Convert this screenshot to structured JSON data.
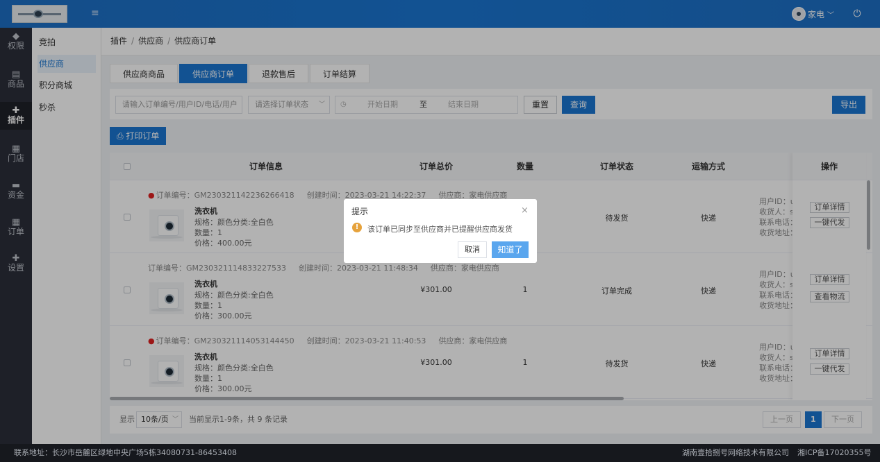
{
  "header": {
    "user_name": "家电",
    "hamburger_glyph": "≡",
    "power_glyph": "⏻",
    "chevron_glyph": "﹀"
  },
  "rail": [
    {
      "icon": "shield-icon",
      "glyph": "◆",
      "label": "权限"
    },
    {
      "icon": "mail-icon",
      "glyph": "▤",
      "label": "商品"
    },
    {
      "icon": "puzzle-icon",
      "glyph": "✚",
      "label": "插件"
    },
    {
      "icon": "doc-icon",
      "glyph": "▦",
      "label": "门店"
    },
    {
      "icon": "wallet-icon",
      "glyph": "▬",
      "label": "资金"
    },
    {
      "icon": "list-icon",
      "glyph": "▦",
      "label": "订单"
    },
    {
      "icon": "puzzle-icon",
      "glyph": "✚",
      "label": "设置"
    }
  ],
  "submenu": [
    "竞拍",
    "供应商",
    "积分商城",
    "秒杀"
  ],
  "breadcrumb": [
    "插件",
    "供应商",
    "供应商订单"
  ],
  "tabs": [
    "供应商商品",
    "供应商订单",
    "退款售后",
    "订单结算"
  ],
  "filters": {
    "search_placeholder": "请输入订单编号/用户ID/电话/用户",
    "status_placeholder": "请选择订单状态",
    "start_date": "开始日期",
    "to": "至",
    "end_date": "结束日期",
    "reset": "重置",
    "query": "查询",
    "export": "导出"
  },
  "print_button": "打印订单",
  "columns": {
    "info": "订单信息",
    "total": "订单总价",
    "qty": "数量",
    "status": "订单状态",
    "shipping": "运输方式",
    "ops": "操作"
  },
  "orders": [
    {
      "order_no": "订单编号：GM230321142236266418",
      "created": "创建时间：2023-03-21 14:22:37",
      "supplier": "供应商：家电供应商",
      "product": "洗衣机",
      "spec": "规格：颜色分类:全白色",
      "qty_line": "数量：1",
      "price_line": "价格：400.00元",
      "total": "",
      "qty": "",
      "status": "待发货",
      "shipping": "快递",
      "user_id": "用户ID：u",
      "receiver": "收货人：s",
      "phone": "联系电话：",
      "address": "收货地址：",
      "btn1": "订单详情",
      "btn2": "一键代发"
    },
    {
      "order_no": "订单编号：GM230321114833227533",
      "created": "创建时间：2023-03-21 11:48:34",
      "supplier": "供应商：家电供应商",
      "product": "洗衣机",
      "spec": "规格：颜色分类:全白色",
      "qty_line": "数量：1",
      "price_line": "价格：300.00元",
      "total": "¥301.00",
      "qty": "1",
      "status": "订单完成",
      "shipping": "快递",
      "user_id": "用户ID：u",
      "receiver": "收货人：s",
      "phone": "联系电话：",
      "address": "收货地址：",
      "btn1": "订单详情",
      "btn2": "查看物流"
    },
    {
      "order_no": "订单编号：GM230321114053144450",
      "created": "创建时间：2023-03-21 11:40:53",
      "supplier": "供应商：家电供应商",
      "product": "洗衣机",
      "spec": "规格：颜色分类:全白色",
      "qty_line": "数量：1",
      "price_line": "价格：300.00元",
      "total": "¥301.00",
      "qty": "1",
      "status": "待发货",
      "shipping": "快递",
      "user_id": "用户ID：u",
      "receiver": "收货人：s",
      "phone": "联系电话：",
      "address": "收货地址：",
      "btn1": "订单详情",
      "btn2": "一键代发"
    }
  ],
  "pager": {
    "show": "显示",
    "page_size": "10条/页",
    "summary": "当前显示1-9条，共 9 条记录",
    "prev": "上一页",
    "current": "1",
    "next": "下一页"
  },
  "dialog": {
    "title": "提示",
    "message": "该订单已同步至供应商并已提醒供应商发货",
    "cancel": "取消",
    "ok": "知道了",
    "close_glyph": "×",
    "warn_glyph": "!"
  },
  "footer": {
    "address": "联系地址：长沙市岳麓区绿地中央广场5栋34080731-86453408",
    "company": "湖南壹拾捌号网络技术有限公司",
    "icp": "湘ICP备17020355号"
  },
  "colors": {
    "primary": "#1a76d2",
    "rail_bg": "#2b2f3a",
    "red_dot": "#e02020",
    "warn": "#e6a23c"
  }
}
